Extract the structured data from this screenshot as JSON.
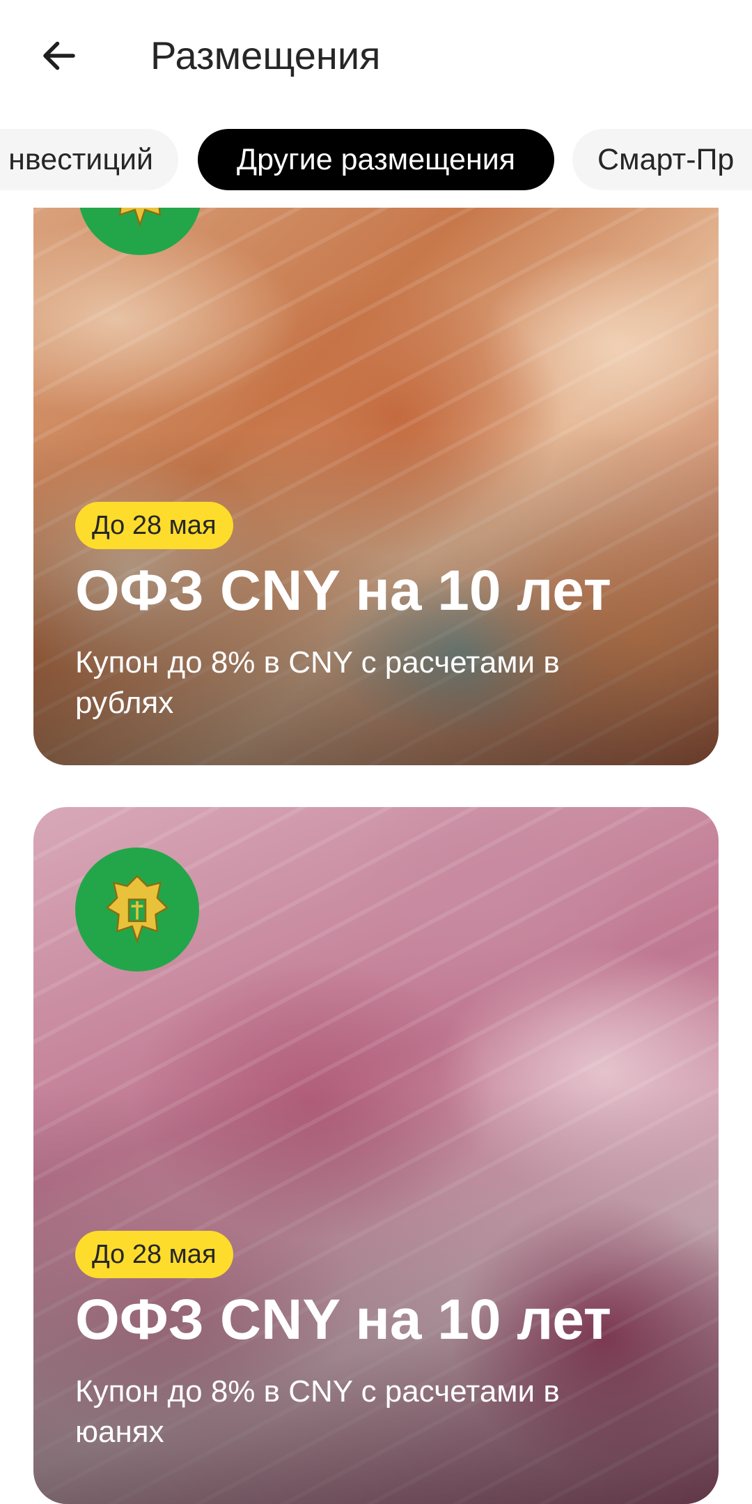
{
  "header": {
    "title": "Размещения",
    "back_icon": "arrow-left-icon"
  },
  "tabs": [
    {
      "label": "нвестиций",
      "active": false
    },
    {
      "label": "Другие размещения",
      "active": true
    },
    {
      "label": "Смарт-Пр",
      "active": false
    }
  ],
  "cards": [
    {
      "badge": "До 28 мая",
      "title": "ОФЗ CNY на 10 лет",
      "subtitle": "Купон до 8% в CNY с расчетами в рублях",
      "image": "rubles-banknotes",
      "logo": "minfin-emblem-icon"
    },
    {
      "badge": "До 28 мая",
      "title": "ОФЗ CNY на 10 лет",
      "subtitle": "Купон до 8% в CNY с расчетами в юанях",
      "image": "yuan-banknotes",
      "logo": "minfin-emblem-icon"
    }
  ],
  "colors": {
    "badge": "#fddc2c",
    "active_tab": "#000000",
    "logo_bg": "#23a64a"
  }
}
